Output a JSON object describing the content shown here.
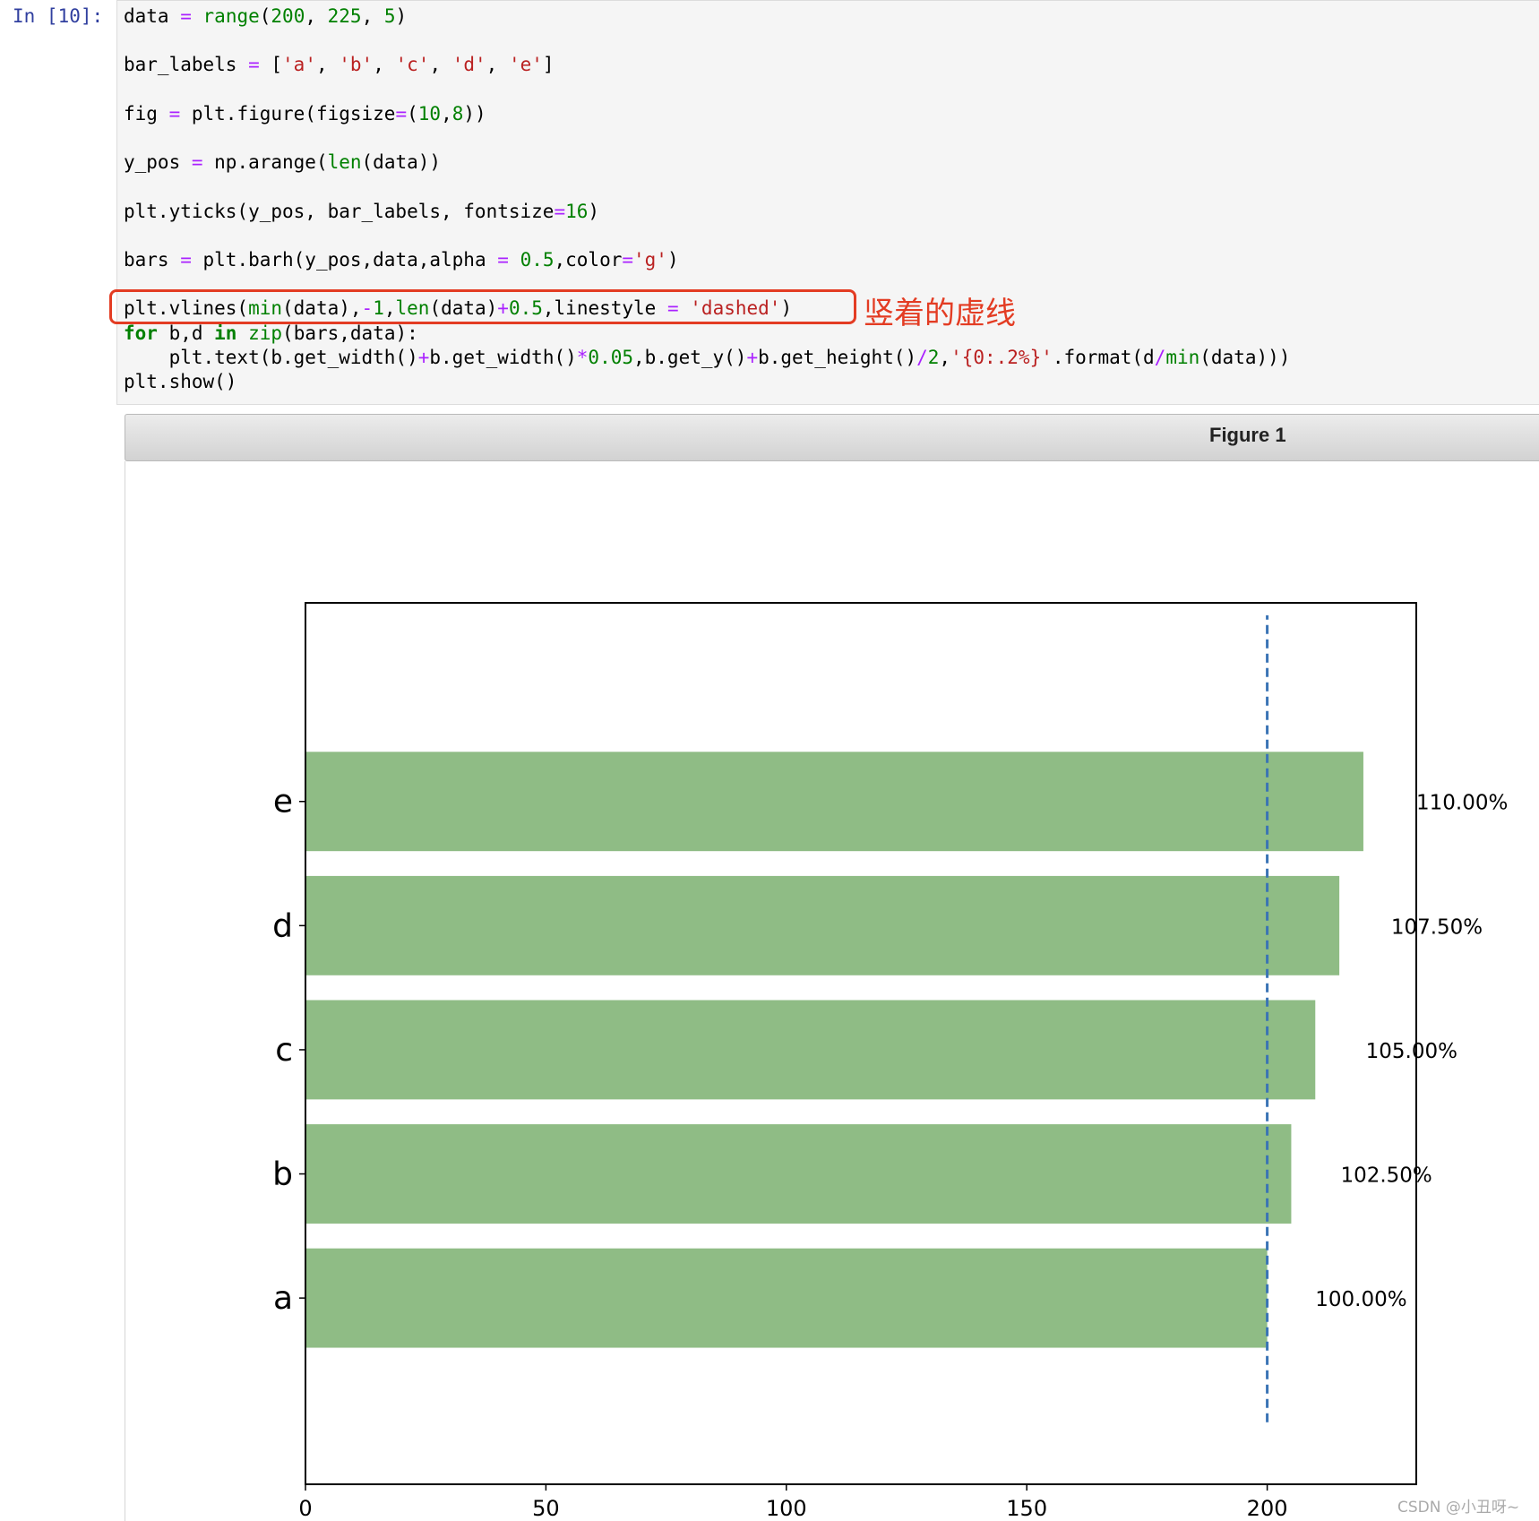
{
  "cell": {
    "prompt": "In [10]:",
    "lines": [
      [
        {
          "t": "data ",
          "c": ""
        },
        {
          "t": "=",
          "c": "op"
        },
        {
          "t": " ",
          "c": ""
        },
        {
          "t": "range",
          "c": "bi"
        },
        {
          "t": "(",
          "c": ""
        },
        {
          "t": "200",
          "c": "num"
        },
        {
          "t": ", ",
          "c": ""
        },
        {
          "t": "225",
          "c": "num"
        },
        {
          "t": ", ",
          "c": ""
        },
        {
          "t": "5",
          "c": "num"
        },
        {
          "t": ")",
          "c": ""
        }
      ],
      [
        {
          "t": "bar_labels ",
          "c": ""
        },
        {
          "t": "=",
          "c": "op"
        },
        {
          "t": " [",
          "c": ""
        },
        {
          "t": "'a'",
          "c": "str"
        },
        {
          "t": ", ",
          "c": ""
        },
        {
          "t": "'b'",
          "c": "str"
        },
        {
          "t": ", ",
          "c": ""
        },
        {
          "t": "'c'",
          "c": "str"
        },
        {
          "t": ", ",
          "c": ""
        },
        {
          "t": "'d'",
          "c": "str"
        },
        {
          "t": ", ",
          "c": ""
        },
        {
          "t": "'e'",
          "c": "str"
        },
        {
          "t": "]",
          "c": ""
        }
      ],
      [
        {
          "t": "fig ",
          "c": ""
        },
        {
          "t": "=",
          "c": "op"
        },
        {
          "t": " plt.figure(figsize",
          "c": ""
        },
        {
          "t": "=",
          "c": "op"
        },
        {
          "t": "(",
          "c": ""
        },
        {
          "t": "10",
          "c": "num"
        },
        {
          "t": ",",
          "c": ""
        },
        {
          "t": "8",
          "c": "num"
        },
        {
          "t": "))",
          "c": ""
        }
      ],
      [
        {
          "t": "y_pos ",
          "c": ""
        },
        {
          "t": "=",
          "c": "op"
        },
        {
          "t": " np.arange(",
          "c": ""
        },
        {
          "t": "len",
          "c": "bi"
        },
        {
          "t": "(data))",
          "c": ""
        }
      ],
      [
        {
          "t": "plt.yticks(y_pos, bar_labels, fontsize",
          "c": ""
        },
        {
          "t": "=",
          "c": "op"
        },
        {
          "t": "16",
          "c": "num"
        },
        {
          "t": ")",
          "c": ""
        }
      ],
      [
        {
          "t": "bars ",
          "c": ""
        },
        {
          "t": "=",
          "c": "op"
        },
        {
          "t": " plt.barh(y_pos,data,alpha ",
          "c": ""
        },
        {
          "t": "=",
          "c": "op"
        },
        {
          "t": " ",
          "c": ""
        },
        {
          "t": "0.5",
          "c": "num"
        },
        {
          "t": ",color",
          "c": ""
        },
        {
          "t": "=",
          "c": "op"
        },
        {
          "t": "'g'",
          "c": "str"
        },
        {
          "t": ")",
          "c": ""
        }
      ],
      [
        {
          "t": "plt.vlines(",
          "c": ""
        },
        {
          "t": "min",
          "c": "bi"
        },
        {
          "t": "(data),",
          "c": ""
        },
        {
          "t": "-",
          "c": "op"
        },
        {
          "t": "1",
          "c": "num"
        },
        {
          "t": ",",
          "c": ""
        },
        {
          "t": "len",
          "c": "bi"
        },
        {
          "t": "(data)",
          "c": ""
        },
        {
          "t": "+",
          "c": "op"
        },
        {
          "t": "0.5",
          "c": "num"
        },
        {
          "t": ",linestyle ",
          "c": ""
        },
        {
          "t": "=",
          "c": "op"
        },
        {
          "t": " ",
          "c": ""
        },
        {
          "t": "'dashed'",
          "c": "str"
        },
        {
          "t": ")",
          "c": ""
        }
      ],
      [
        {
          "t": "for",
          "c": "kw"
        },
        {
          "t": " b,d ",
          "c": ""
        },
        {
          "t": "in",
          "c": "kw"
        },
        {
          "t": " ",
          "c": ""
        },
        {
          "t": "zip",
          "c": "bi"
        },
        {
          "t": "(bars,data):",
          "c": ""
        }
      ],
      [
        {
          "t": "    plt.text(b.get_width()",
          "c": ""
        },
        {
          "t": "+",
          "c": "op"
        },
        {
          "t": "b.get_width()",
          "c": ""
        },
        {
          "t": "*",
          "c": "op"
        },
        {
          "t": "0.05",
          "c": "num"
        },
        {
          "t": ",b.get_y()",
          "c": ""
        },
        {
          "t": "+",
          "c": "op"
        },
        {
          "t": "b.get_height()",
          "c": ""
        },
        {
          "t": "/",
          "c": "op"
        },
        {
          "t": "2",
          "c": "num"
        },
        {
          "t": ",",
          "c": ""
        },
        {
          "t": "'{0:.2%}'",
          "c": "str"
        },
        {
          "t": ".format(d",
          "c": ""
        },
        {
          "t": "/",
          "c": "op"
        },
        {
          "t": "min",
          "c": "bi"
        },
        {
          "t": "(data)))",
          "c": ""
        }
      ],
      [
        {
          "t": "plt.show()",
          "c": ""
        }
      ]
    ]
  },
  "annotation": {
    "text": "竖着的虚线",
    "color": "#e33c23"
  },
  "figure": {
    "title": "Figure 1"
  },
  "watermark": "CSDN @小丑呀~",
  "chart_data": {
    "type": "bar",
    "orientation": "horizontal",
    "categories": [
      "a",
      "b",
      "c",
      "d",
      "e"
    ],
    "values": [
      200,
      205,
      210,
      215,
      220
    ],
    "bar_labels": [
      "100.00%",
      "102.50%",
      "105.00%",
      "107.50%",
      "110.00%"
    ],
    "bar_color": "#8fbc85",
    "x_ticks": [
      0,
      50,
      100,
      150,
      200
    ],
    "xlim": [
      0,
      231
    ],
    "ylim": [
      -1.5,
      5.6
    ],
    "vline": {
      "x": 200,
      "ymin": -1,
      "ymax": 5.5,
      "style": "dashed",
      "color": "#3a74b5"
    },
    "xlabel": "",
    "ylabel": "",
    "title": ""
  }
}
